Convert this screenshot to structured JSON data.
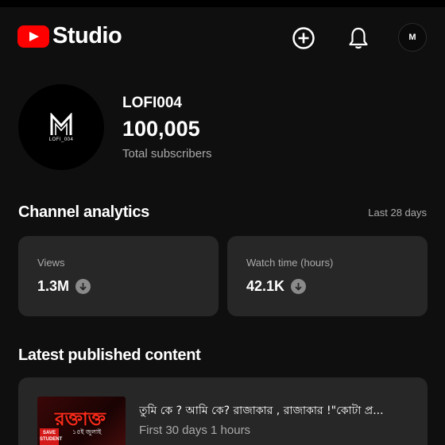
{
  "header": {
    "app_name": "Studio",
    "icons": [
      "youtube-logo-icon",
      "create-icon",
      "bell-icon",
      "account-avatar-icon"
    ],
    "avatar_initial": "M",
    "accent_color": "#ff0000"
  },
  "channel": {
    "name": "LOFI004",
    "subscribers": "100,005",
    "subscribers_label": "Total subscribers",
    "avatar_caption": "LOFI_004"
  },
  "analytics": {
    "title": "Channel analytics",
    "period": "Last 28 days",
    "cards": [
      {
        "label": "Views",
        "value": "1.3M",
        "trend": "down"
      },
      {
        "label": "Watch time (hours)",
        "value": "42.1K",
        "trend": "down"
      }
    ]
  },
  "latest": {
    "title": "Latest published content",
    "item": {
      "title": "তুমি কে ? আমি কে?  রাজাকার , রাজাকার !\"কোটা প্র...",
      "meta": "First 30 days 1 hours",
      "thumbnail_text": "রক্তাক্ত",
      "thumbnail_date": "১৫ই জুলাই",
      "thumbnail_badge": "SAVE STUDENT"
    }
  }
}
